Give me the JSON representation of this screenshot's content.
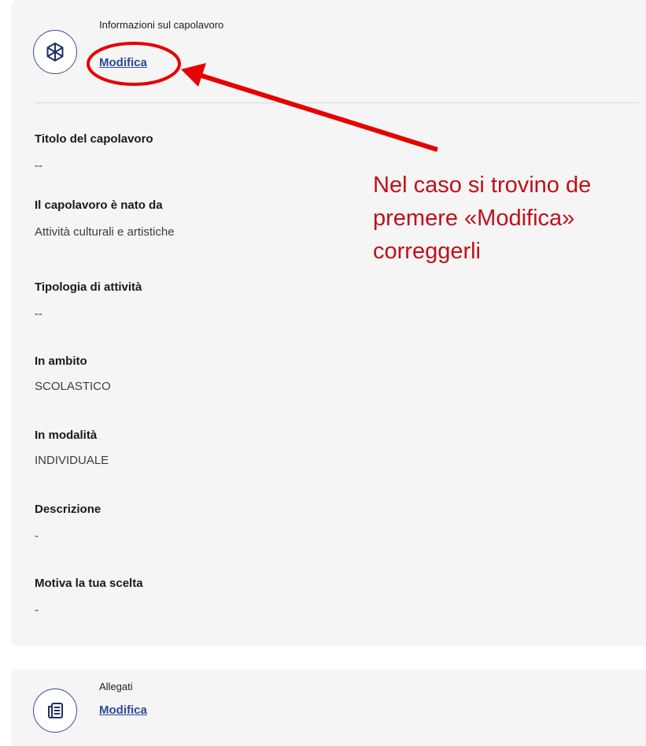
{
  "card_info": {
    "section_title": "Informazioni sul capolavoro",
    "edit_label": "Modifica",
    "icon": "cube-icon",
    "fields": [
      {
        "label": "Titolo del capolavoro",
        "value": "--"
      },
      {
        "label": "Il capolavoro è nato da",
        "value": "Attività culturali e artistiche"
      },
      {
        "label": "Tipologia di attività",
        "value": "--"
      },
      {
        "label": "In ambito",
        "value": "SCOLASTICO"
      },
      {
        "label": "In modalità",
        "value": "INDIVIDUALE"
      },
      {
        "label": "Descrizione",
        "value": "-"
      },
      {
        "label": "Motiva la tua scelta",
        "value": "-"
      }
    ]
  },
  "card_attachments": {
    "section_title": "Allegati",
    "edit_label": "Modifica",
    "icon": "document-list-icon"
  },
  "annotation": {
    "line1": "Nel caso si trovino de",
    "line2": "premere «Modifica»",
    "line3": "correggerli",
    "color": "#c0101a"
  }
}
